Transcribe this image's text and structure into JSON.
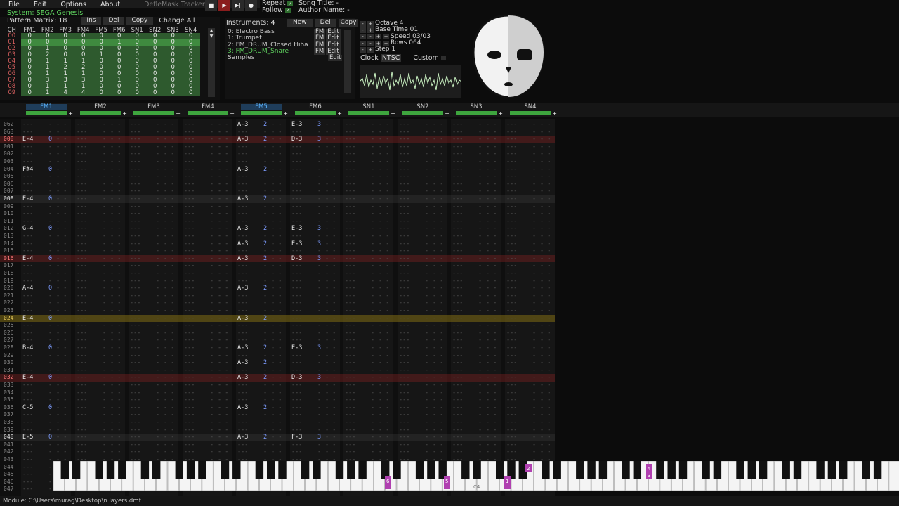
{
  "menu": {
    "items": [
      "File",
      "Edit",
      "Options",
      "About"
    ],
    "app_title": "DefleMask Tracker"
  },
  "system_label": "System: SEGA Genesis",
  "transport": {
    "repeat_label": "Repeat",
    "follow_label": "Follow",
    "song_title": "Song Title: -",
    "author_name": "Author Name: -"
  },
  "pattern_matrix": {
    "title": "Pattern Matrix: 18",
    "buttons": [
      "Ins",
      "Del",
      "Copy",
      "Change All"
    ],
    "columns": [
      "CH",
      "FM1",
      "FM2",
      "FM3",
      "FM4",
      "FM5",
      "FM6",
      "SN1",
      "SN2",
      "SN3",
      "SN4"
    ],
    "rows": [
      [
        "00",
        "0",
        "0",
        "0",
        "0",
        "0",
        "0",
        "0",
        "0",
        "0",
        "0"
      ],
      [
        "01",
        "0",
        "0",
        "0",
        "0",
        "0",
        "1",
        "0",
        "0",
        "0",
        "0"
      ],
      [
        "02",
        "0",
        "1",
        "0",
        "0",
        "0",
        "0",
        "0",
        "0",
        "0",
        "0"
      ],
      [
        "03",
        "0",
        "2",
        "0",
        "0",
        "1",
        "0",
        "0",
        "0",
        "0",
        "0"
      ],
      [
        "04",
        "0",
        "1",
        "1",
        "1",
        "0",
        "0",
        "0",
        "0",
        "0",
        "0"
      ],
      [
        "05",
        "0",
        "1",
        "2",
        "2",
        "0",
        "0",
        "0",
        "0",
        "0",
        "0"
      ],
      [
        "06",
        "0",
        "1",
        "1",
        "1",
        "0",
        "0",
        "0",
        "0",
        "0",
        "0"
      ],
      [
        "07",
        "0",
        "3",
        "3",
        "3",
        "0",
        "1",
        "0",
        "0",
        "0",
        "0"
      ],
      [
        "08",
        "0",
        "1",
        "1",
        "1",
        "0",
        "0",
        "0",
        "0",
        "0",
        "0"
      ],
      [
        "09",
        "0",
        "1",
        "4",
        "4",
        "0",
        "0",
        "0",
        "0",
        "0",
        "0"
      ]
    ]
  },
  "instruments": {
    "title": "Instruments: 4",
    "buttons": [
      "New",
      "Del",
      "Copy"
    ],
    "items": [
      {
        "label": "0: Electro Bass",
        "type": "FM",
        "edit": "Edit"
      },
      {
        "label": "1: Trumpet",
        "type": "FM",
        "edit": "Edit"
      },
      {
        "label": "2: FM_DRUM_Closed Hiha",
        "type": "FM",
        "edit": "Edit"
      },
      {
        "label": "3: FM_DRUM_Snare",
        "type": "FM",
        "edit": "Edit"
      }
    ],
    "samples_label": "Samples",
    "samples_edit": "Edit"
  },
  "song_settings": {
    "octave": "Octave 4",
    "base_time": "Base Time 01",
    "speed": "Speed 03/03",
    "rows": "Rows 064",
    "step": "Step 1",
    "clock_label": "Clock",
    "clock_value": "NTSC",
    "custom_label": "Custom"
  },
  "channels": [
    "FM1",
    "FM2",
    "FM3",
    "FM4",
    "FM5",
    "FM6",
    "SN1",
    "SN2",
    "SN3",
    "SN4"
  ],
  "pattern_rows": [
    {
      "n": "062",
      "fm1": "",
      "fm5": "A-3",
      "fm5i": "2",
      "fm6": "E-3",
      "fm6i": "3"
    },
    {
      "n": "063"
    },
    {
      "n": "000",
      "fm1": "E-4",
      "fm1i": "0",
      "fm5": "A-3",
      "fm5i": "2",
      "fm6": "D-3",
      "fm6i": "3"
    },
    {
      "n": "001"
    },
    {
      "n": "002"
    },
    {
      "n": "003"
    },
    {
      "n": "004",
      "fm1": "F#4",
      "fm1i": "0",
      "fm5": "A-3",
      "fm5i": "2"
    },
    {
      "n": "005"
    },
    {
      "n": "006"
    },
    {
      "n": "007"
    },
    {
      "n": "008",
      "fm1": "E-4",
      "fm1i": "0",
      "fm5": "A-3",
      "fm5i": "2"
    },
    {
      "n": "009"
    },
    {
      "n": "010"
    },
    {
      "n": "011"
    },
    {
      "n": "012",
      "fm1": "G-4",
      "fm1i": "0",
      "fm5": "A-3",
      "fm5i": "2",
      "fm6": "E-3",
      "fm6i": "3"
    },
    {
      "n": "013"
    },
    {
      "n": "014",
      "fm5": "A-3",
      "fm5i": "2",
      "fm6": "E-3",
      "fm6i": "3"
    },
    {
      "n": "015"
    },
    {
      "n": "016",
      "fm1": "E-4",
      "fm1i": "0",
      "fm5": "A-3",
      "fm5i": "2",
      "fm6": "D-3",
      "fm6i": "3"
    },
    {
      "n": "017"
    },
    {
      "n": "018"
    },
    {
      "n": "019"
    },
    {
      "n": "020",
      "fm1": "A-4",
      "fm1i": "0",
      "fm5": "A-3",
      "fm5i": "2"
    },
    {
      "n": "021"
    },
    {
      "n": "022"
    },
    {
      "n": "023"
    },
    {
      "n": "024",
      "fm1": "E-4",
      "fm1i": "0",
      "fm5": "A-3",
      "fm5i": "2"
    },
    {
      "n": "025"
    },
    {
      "n": "026"
    },
    {
      "n": "027"
    },
    {
      "n": "028",
      "fm1": "B-4",
      "fm1i": "0",
      "fm5": "A-3",
      "fm5i": "2",
      "fm6": "E-3",
      "fm6i": "3"
    },
    {
      "n": "029"
    },
    {
      "n": "030",
      "fm5": "A-3",
      "fm5i": "2"
    },
    {
      "n": "031"
    },
    {
      "n": "032",
      "fm1": "E-4",
      "fm1i": "0",
      "fm5": "A-3",
      "fm5i": "2",
      "fm6": "D-3",
      "fm6i": "3"
    },
    {
      "n": "033"
    },
    {
      "n": "034"
    },
    {
      "n": "035"
    },
    {
      "n": "036",
      "fm1": "C-5",
      "fm1i": "0",
      "fm5": "A-3",
      "fm5i": "2"
    },
    {
      "n": "037"
    },
    {
      "n": "038"
    },
    {
      "n": "039"
    },
    {
      "n": "040",
      "fm1": "E-5",
      "fm1i": "0",
      "fm5": "A-3",
      "fm5i": "2",
      "fm6": "F-3",
      "fm6i": "3"
    },
    {
      "n": "041"
    },
    {
      "n": "042"
    },
    {
      "n": "043"
    },
    {
      "n": "044"
    },
    {
      "n": "045"
    },
    {
      "n": "046"
    },
    {
      "n": "047"
    }
  ],
  "keyboard": {
    "label_c4": "C4",
    "pressed": [
      {
        "label": "6"
      },
      {
        "label": "5"
      },
      {
        "label": "1"
      },
      {
        "label": "2"
      },
      {
        "label": "4"
      },
      {
        "label": "3"
      }
    ]
  },
  "status": "Module: C:\\Users\\murag\\Desktop\\n layers.dmf",
  "colors": {
    "accent_green": "#3ea53e",
    "active_blue": "#5ab4ff",
    "cursor_row": "#8a7a14",
    "beat_row": "#6e1c1c",
    "pressed_key": "#b040b0"
  }
}
